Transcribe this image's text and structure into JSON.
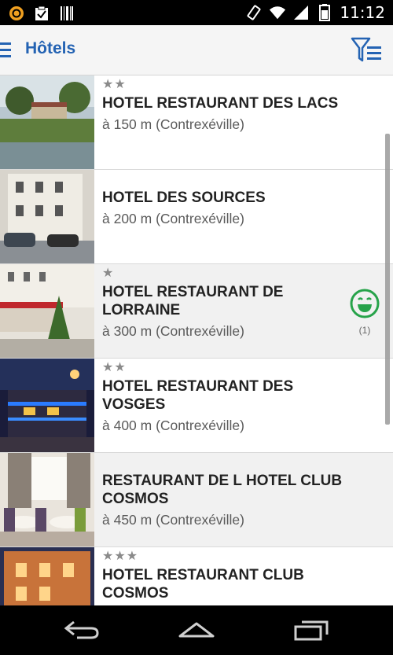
{
  "status": {
    "time": "11:12"
  },
  "appbar": {
    "title": "Hôtels"
  },
  "hotels": [
    {
      "stars": "★★",
      "name": "HOTEL RESTAURANT DES LACS",
      "distance": "à 150 m (Contrexéville)",
      "rating": null
    },
    {
      "stars": "",
      "name": "HOTEL DES SOURCES",
      "distance": "à 200 m (Contrexéville)",
      "rating": null
    },
    {
      "stars": "★",
      "name": "HOTEL RESTAURANT DE LORRAINE",
      "distance": "à 300 m (Contrexéville)",
      "rating": "(1)"
    },
    {
      "stars": "★★",
      "name": "HOTEL RESTAURANT DES VOSGES",
      "distance": "à 400 m (Contrexéville)",
      "rating": null
    },
    {
      "stars": "",
      "name": "RESTAURANT DE L HOTEL CLUB COSMOS",
      "distance": "à 450 m (Contrexéville)",
      "rating": null
    },
    {
      "stars": "★★★",
      "name": "HOTEL RESTAURANT CLUB COSMOS",
      "distance": "",
      "rating": null
    }
  ],
  "colors": {
    "accent": "#2463b3",
    "rating": "#27a34a"
  }
}
